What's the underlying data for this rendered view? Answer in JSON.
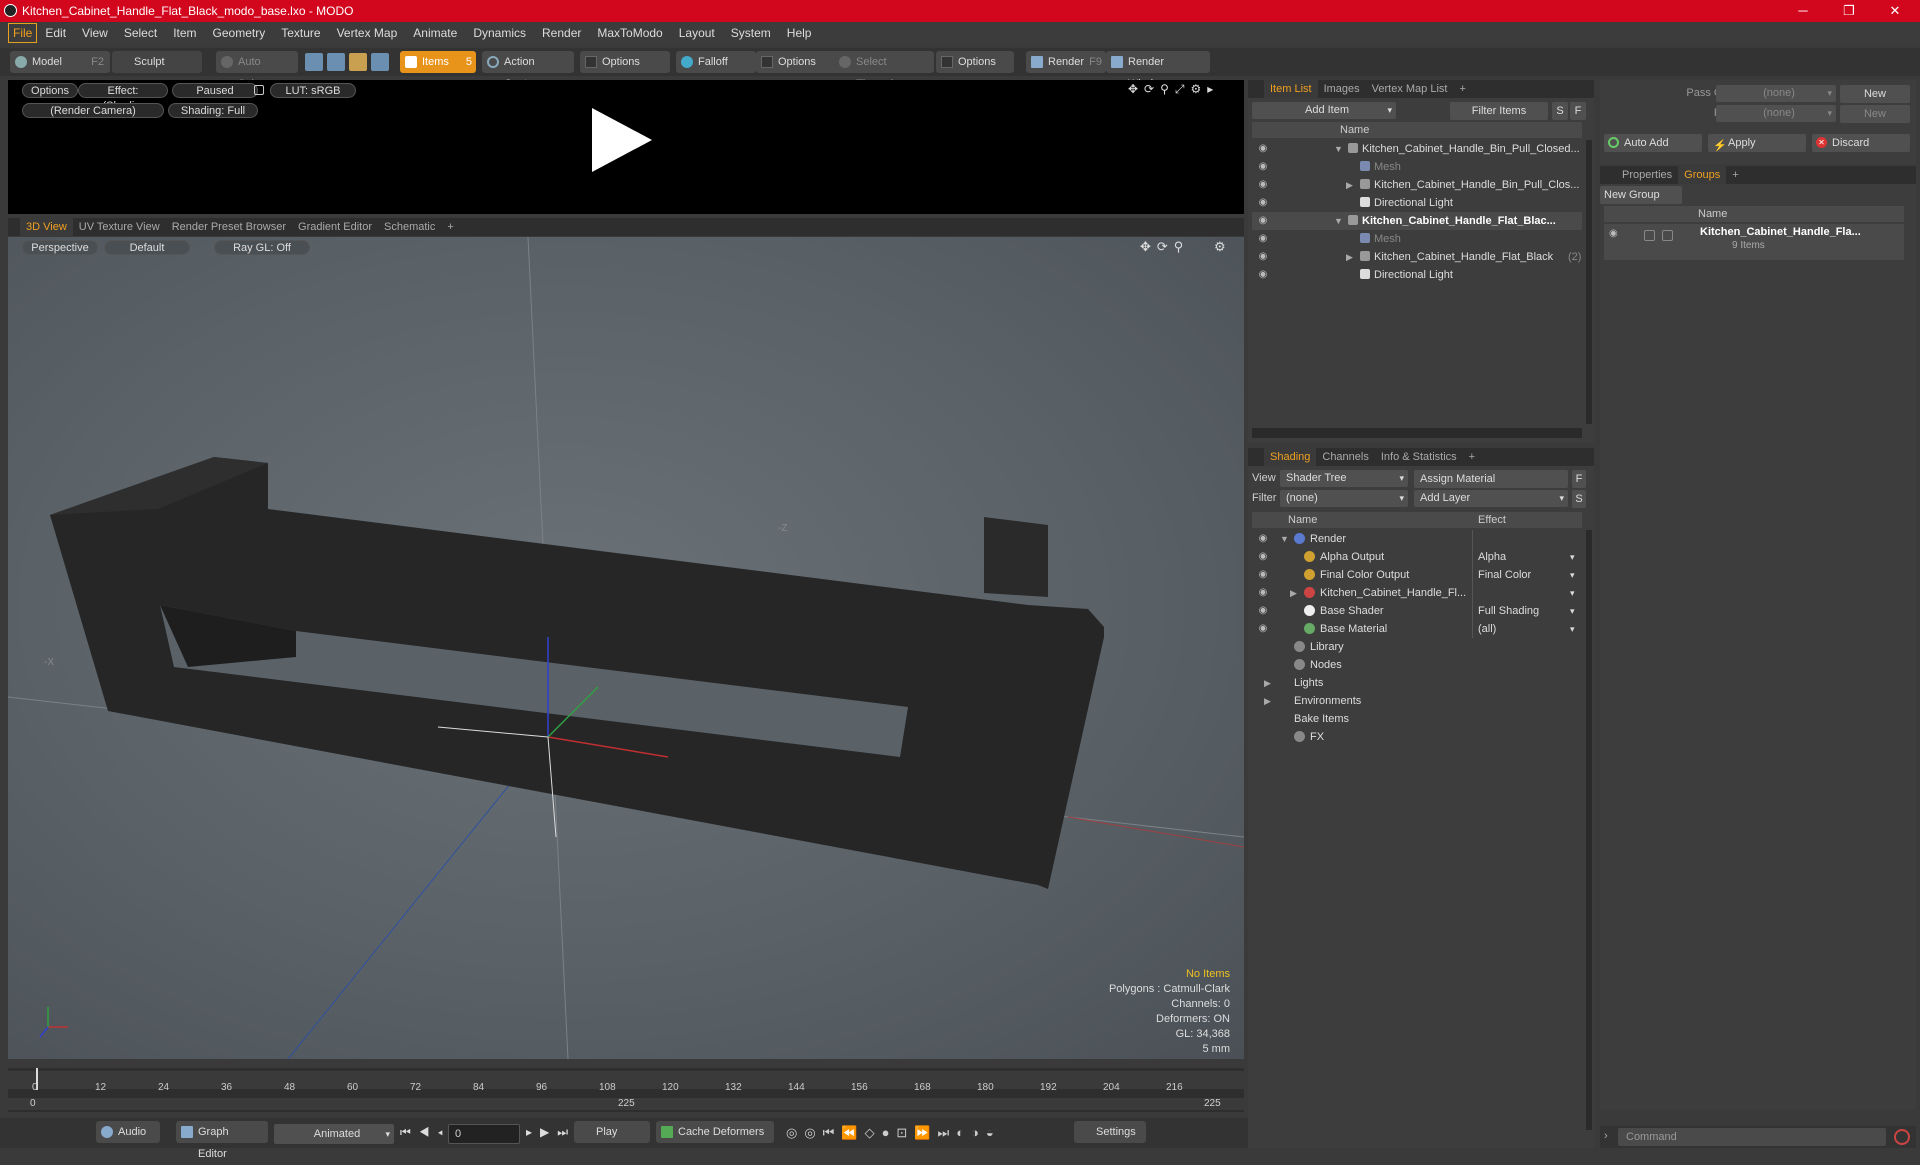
{
  "window": {
    "title": "Kitchen_Cabinet_Handle_Flat_Black_modo_base.lxo - MODO",
    "min": "─",
    "max": "❐",
    "close": "✕"
  },
  "menu": [
    "File",
    "Edit",
    "View",
    "Select",
    "Item",
    "Geometry",
    "Texture",
    "Vertex Map",
    "Animate",
    "Dynamics",
    "Render",
    "MaxToModo",
    "Layout",
    "System",
    "Help"
  ],
  "toolbar": {
    "model": "Model",
    "model_key": "F2",
    "sculpt": "Sculpt",
    "auto_select": "Auto Select",
    "items": "Items",
    "items_key": "5",
    "action_center": "Action Center",
    "options1": "Options",
    "falloff": "Falloff",
    "options2": "Options",
    "select_through": "Select Through",
    "options3": "Options",
    "render": "Render",
    "render_key": "F9",
    "render_window": "Render Window"
  },
  "preview": {
    "options": "Options",
    "effect": "Effect: (Shadi...",
    "paused": "Paused",
    "lut": "LUT: sRGB",
    "camera": "(Render Camera)",
    "shading": "Shading: Full"
  },
  "viewport_tabs": [
    "3D View",
    "UV Texture View",
    "Render Preset Browser",
    "Gradient Editor",
    "Schematic",
    "+"
  ],
  "viewport": {
    "perspective": "Perspective",
    "default": "Default",
    "raygl": "Ray GL: Off",
    "info": {
      "no_items": "No Items",
      "polygons": "Polygons : Catmull-Clark",
      "channels": "Channels: 0",
      "deformers": "Deformers: ON",
      "gl": "GL: 34,368",
      "unit": "5 mm"
    },
    "axis_z": "-Z",
    "axis_x": "-X"
  },
  "timeline": {
    "ticks": [
      "0",
      "12",
      "24",
      "36",
      "48",
      "60",
      "72",
      "84",
      "96",
      "108",
      "120",
      "132",
      "144",
      "156",
      "168",
      "180",
      "192",
      "204",
      "216"
    ],
    "range_start": "0",
    "range_mid": "225",
    "range_end": "225"
  },
  "bottombar": {
    "audio": "Audio",
    "graph_editor": "Graph Editor",
    "animated": "Animated",
    "frame": "0",
    "play": "Play",
    "cache": "Cache Deformers",
    "settings": "Settings"
  },
  "itemlist": {
    "tabs": [
      "Item List",
      "Images",
      "Vertex Map List",
      "+"
    ],
    "add_item": "Add Item",
    "filter": "Filter Items",
    "s": "S",
    "f": "F",
    "col_name": "Name",
    "rows": [
      {
        "label": "Kitchen_Cabinet_Handle_Bin_Pull_Closed...",
        "indent": 0,
        "arrow": "▼",
        "bold": false
      },
      {
        "label": "Mesh",
        "indent": 1,
        "arrow": "",
        "dim": true
      },
      {
        "label": "Kitchen_Cabinet_Handle_Bin_Pull_Clos...",
        "indent": 1,
        "arrow": "▶"
      },
      {
        "label": "Directional Light",
        "indent": 1,
        "arrow": ""
      },
      {
        "label": "Kitchen_Cabinet_Handle_Flat_Blac...",
        "indent": 0,
        "arrow": "▼",
        "bold": true
      },
      {
        "label": "Mesh",
        "indent": 1,
        "arrow": "",
        "dim": true
      },
      {
        "label": "Kitchen_Cabinet_Handle_Flat_Black",
        "indent": 1,
        "arrow": "▶",
        "suffix": "(2)"
      },
      {
        "label": "Directional Light",
        "indent": 1,
        "arrow": ""
      }
    ]
  },
  "shading": {
    "tabs": [
      "Shading",
      "Channels",
      "Info & Statistics",
      "+"
    ],
    "view_label": "View",
    "view_value": "Shader Tree",
    "assign": "Assign Material",
    "filter_label": "Filter",
    "filter_value": "(none)",
    "add_layer": "Add Layer",
    "f": "F",
    "s": "S",
    "col_name": "Name",
    "col_effect": "Effect",
    "rows": [
      {
        "label": "Render",
        "effect": "",
        "indent": 0,
        "arrow": "▼"
      },
      {
        "label": "Alpha Output",
        "effect": "Alpha",
        "indent": 1
      },
      {
        "label": "Final Color Output",
        "effect": "Final Color",
        "indent": 1
      },
      {
        "label": "Kitchen_Cabinet_Handle_Fl...",
        "effect": "",
        "indent": 1,
        "arrow": "▶"
      },
      {
        "label": "Base Shader",
        "effect": "Full Shading",
        "indent": 1
      },
      {
        "label": "Base Material",
        "effect": "(all)",
        "indent": 1
      },
      {
        "label": "Library",
        "effect": "",
        "indent": 0
      },
      {
        "label": "Nodes",
        "effect": "",
        "indent": 0
      },
      {
        "label": "Lights",
        "effect": "",
        "indent": -1,
        "arrow": "▶"
      },
      {
        "label": "Environments",
        "effect": "",
        "indent": -1,
        "arrow": "▶"
      },
      {
        "label": "Bake Items",
        "effect": "",
        "indent": -1
      },
      {
        "label": "FX",
        "effect": "",
        "indent": 0
      }
    ]
  },
  "passes": {
    "pass_groups": "Pass Groups",
    "passes": "Passes",
    "none": "(none)",
    "new": "New",
    "auto_add": "Auto Add",
    "apply": "Apply",
    "discard": "Discard"
  },
  "groups": {
    "tabs": [
      "Properties",
      "Groups",
      "+"
    ],
    "new_group": "New Group",
    "col_name": "Name",
    "item": "Kitchen_Cabinet_Handle_Fla...",
    "count": "9 Items"
  },
  "command": {
    "placeholder": "Command"
  },
  "colors": {
    "accent": "#f0a020",
    "title": "#d2071e"
  }
}
